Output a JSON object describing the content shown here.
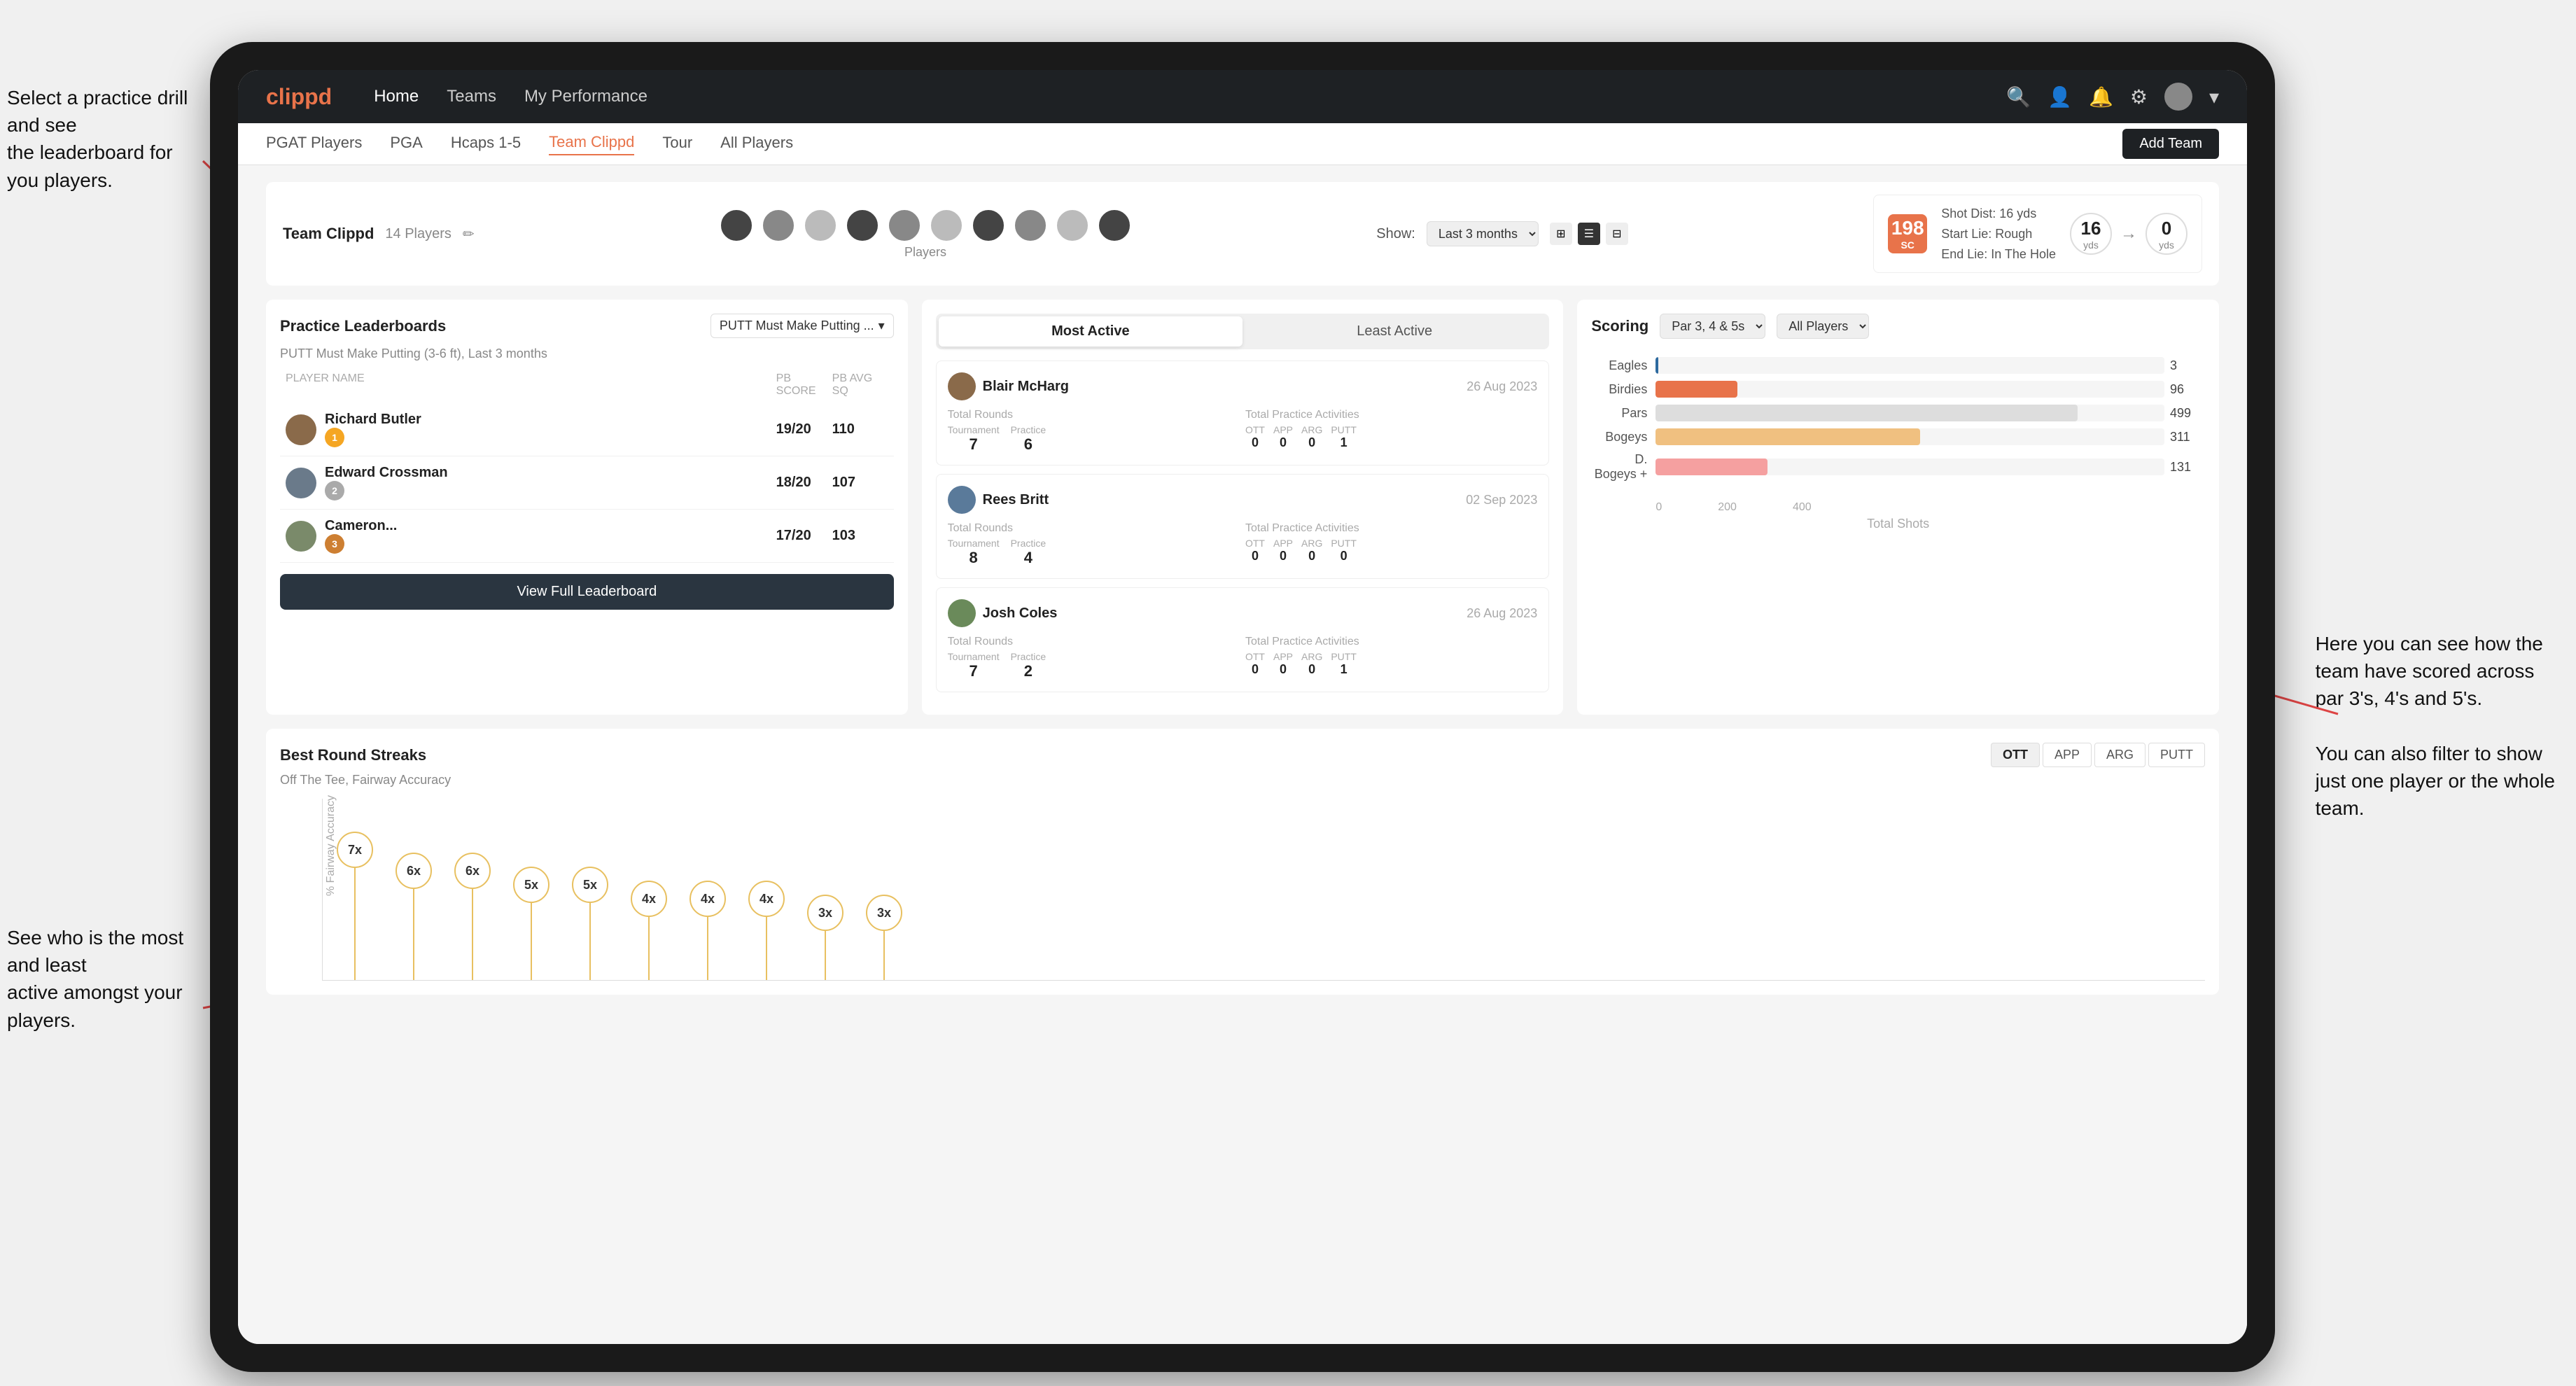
{
  "annotations": {
    "top_left": "Select a practice drill and see\nthe leaderboard for you players.",
    "bottom_left": "See who is the most and least\nactive amongst your players.",
    "right": "Here you can see how the\nteam have scored across\npar 3's, 4's and 5's.\n\nYou can also filter to show\njust one player or the whole\nteam."
  },
  "navbar": {
    "logo": "clippd",
    "links": [
      "Home",
      "Teams",
      "My Performance"
    ],
    "icons": [
      "search",
      "person",
      "bell",
      "settings"
    ]
  },
  "subnav": {
    "items": [
      "PGAT Players",
      "PGA",
      "Hcaps 1-5",
      "Team Clippd",
      "Tour",
      "All Players"
    ],
    "active": "Team Clippd",
    "add_team_label": "Add Team"
  },
  "team_header": {
    "title": "Team Clippd",
    "count": "14 Players",
    "show_label": "Show:",
    "show_value": "Last 3 months",
    "players_label": "Players",
    "shot_badge": "198",
    "shot_badge_sub": "SC",
    "shot_dist": "Shot Dist: 16 yds",
    "start_lie": "Start Lie: Rough",
    "end_lie": "End Lie: In The Hole",
    "circle1_val": "16",
    "circle1_unit": "yds",
    "circle2_val": "0",
    "circle2_unit": "yds"
  },
  "practice_leaderboard": {
    "title": "Practice Leaderboards",
    "dropdown": "PUTT Must Make Putting ...",
    "drill_name": "PUTT Must Make Putting (3-6 ft),",
    "drill_period": "Last 3 months",
    "col_player": "PLAYER NAME",
    "col_score": "PB SCORE",
    "col_avg": "PB AVG SQ",
    "players": [
      {
        "name": "Richard Butler",
        "score": "19/20",
        "avg": "110",
        "medal": "gold",
        "rank": 1
      },
      {
        "name": "Edward Crossman",
        "score": "18/20",
        "avg": "107",
        "medal": "silver",
        "rank": 2
      },
      {
        "name": "Cameron...",
        "score": "17/20",
        "avg": "103",
        "medal": "bronze",
        "rank": 3
      }
    ],
    "view_full_label": "View Full Leaderboard"
  },
  "activity": {
    "most_active_label": "Most Active",
    "least_active_label": "Least Active",
    "active_tab": "most",
    "players": [
      {
        "name": "Blair McHarg",
        "date": "26 Aug 2023",
        "total_rounds_label": "Total Rounds",
        "tournament": "7",
        "practice": "6",
        "total_practice_label": "Total Practice Activities",
        "ott": "0",
        "app": "0",
        "arg": "0",
        "putt": "1"
      },
      {
        "name": "Rees Britt",
        "date": "02 Sep 2023",
        "total_rounds_label": "Total Rounds",
        "tournament": "8",
        "practice": "4",
        "total_practice_label": "Total Practice Activities",
        "ott": "0",
        "app": "0",
        "arg": "0",
        "putt": "0"
      },
      {
        "name": "Josh Coles",
        "date": "26 Aug 2023",
        "total_rounds_label": "Total Rounds",
        "tournament": "7",
        "practice": "2",
        "total_practice_label": "Total Practice Activities",
        "ott": "0",
        "app": "0",
        "arg": "0",
        "putt": "1"
      }
    ]
  },
  "scoring": {
    "title": "Scoring",
    "filter1": "Par 3, 4 & 5s",
    "filter2": "All Players",
    "bars": [
      {
        "label": "Eagles",
        "value": 3,
        "max": 600,
        "color": "eagles"
      },
      {
        "label": "Birdies",
        "value": 96,
        "max": 600,
        "color": "birdies"
      },
      {
        "label": "Pars",
        "value": 499,
        "max": 600,
        "color": "pars"
      },
      {
        "label": "Bogeys",
        "value": 311,
        "max": 600,
        "color": "bogeys"
      },
      {
        "label": "D. Bogeys +",
        "value": 131,
        "max": 600,
        "color": "dbogeys"
      }
    ],
    "axis_labels": [
      "0",
      "200",
      "400"
    ],
    "footer": "Total Shots"
  },
  "streaks": {
    "title": "Best Round Streaks",
    "subtitle": "Off The Tee, Fairway Accuracy",
    "filters": [
      "OTT",
      "APP",
      "ARG",
      "PUTT"
    ],
    "active_filter": "OTT",
    "bubbles": [
      {
        "count": "7x",
        "height": 160
      },
      {
        "count": "6x",
        "height": 130
      },
      {
        "count": "6x",
        "height": 130
      },
      {
        "count": "5x",
        "height": 110
      },
      {
        "count": "5x",
        "height": 110
      },
      {
        "count": "4x",
        "height": 90
      },
      {
        "count": "4x",
        "height": 90
      },
      {
        "count": "4x",
        "height": 90
      },
      {
        "count": "3x",
        "height": 70
      },
      {
        "count": "3x",
        "height": 70
      }
    ]
  }
}
